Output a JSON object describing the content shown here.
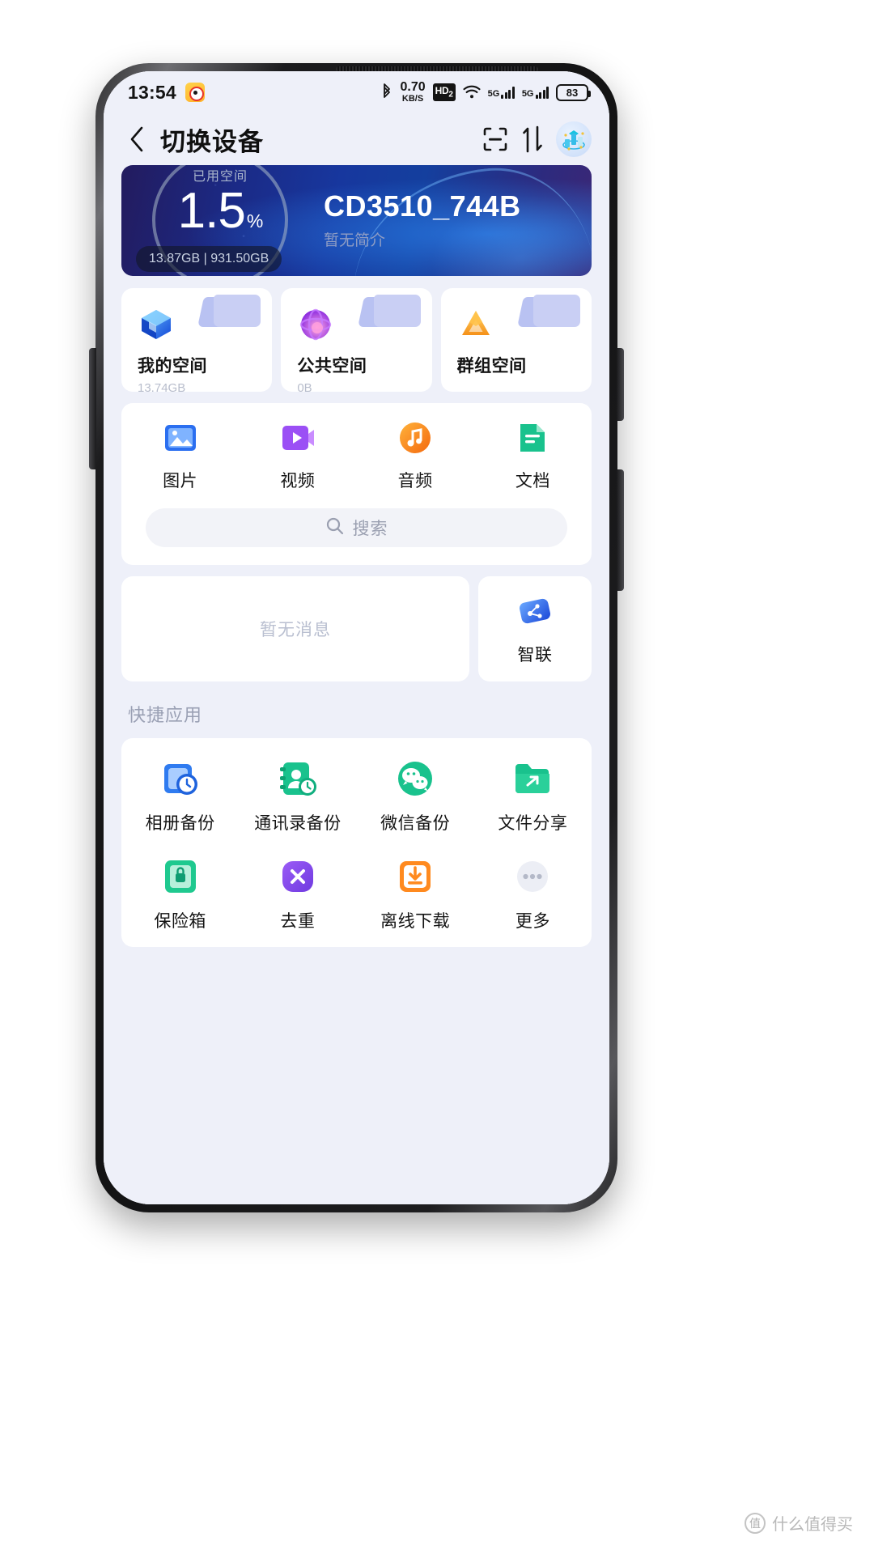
{
  "statusbar": {
    "time": "13:54",
    "app_icon": "weibo-icon",
    "bluetooth_icon": "bluetooth-icon",
    "net_speed_value": "0.70",
    "net_speed_unit": "KB/S",
    "hd_badge": "HD",
    "hd_sub": "2",
    "wifi_icon": "wifi-icon",
    "sim1_label": "5G",
    "sim2_label": "5G",
    "battery_level": "83"
  },
  "header": {
    "back_icon": "chevron-left-icon",
    "title": "切换设备",
    "scan_icon": "scan-icon",
    "transfer_icon": "transfer-updown-icon",
    "avatar_icon": "user-avatar-icon"
  },
  "hero": {
    "gauge_label": "已用空间",
    "percent": "1.5",
    "percent_symbol": "%",
    "storage_pill": "13.87GB | 931.50GB",
    "device_name": "CD3510_744B",
    "device_desc": "暂无简介"
  },
  "folders": [
    {
      "name": "我的空间",
      "size": "13.74GB",
      "icon": "blue-cube-icon"
    },
    {
      "name": "公共空间",
      "size": "0B",
      "icon": "purple-orb-icon"
    },
    {
      "name": "群组空间",
      "size": "",
      "icon": "orange-triangle-icon"
    }
  ],
  "media": {
    "items": [
      {
        "label": "图片",
        "icon": "image-icon"
      },
      {
        "label": "视频",
        "icon": "video-icon"
      },
      {
        "label": "音频",
        "icon": "audio-icon"
      },
      {
        "label": "文档",
        "icon": "document-icon"
      }
    ],
    "search_placeholder": "搜索",
    "search_icon": "search-icon"
  },
  "messages": {
    "empty_text": "暂无消息",
    "zhilian_label": "智联",
    "zhilian_icon": "network-nodes-icon"
  },
  "quick_apps": {
    "section_title": "快捷应用",
    "items": [
      {
        "label": "相册备份",
        "icon": "album-backup-icon"
      },
      {
        "label": "通讯录备份",
        "icon": "contacts-backup-icon"
      },
      {
        "label": "微信备份",
        "icon": "wechat-backup-icon"
      },
      {
        "label": "文件分享",
        "icon": "file-share-icon"
      },
      {
        "label": "保险箱",
        "icon": "safe-box-icon"
      },
      {
        "label": "去重",
        "icon": "deduplicate-icon"
      },
      {
        "label": "离线下载",
        "icon": "offline-download-icon"
      },
      {
        "label": "更多",
        "icon": "more-dots-icon"
      }
    ]
  },
  "watermark": {
    "text": "什么值得买"
  },
  "colors": {
    "accent_blue": "#1a4bd0",
    "hero_dark": "#231b5e",
    "bg": "#eef0f9",
    "card": "#ffffff",
    "green": "#21c08a",
    "orange": "#ff8a1f",
    "purple": "#9a4ff0"
  }
}
